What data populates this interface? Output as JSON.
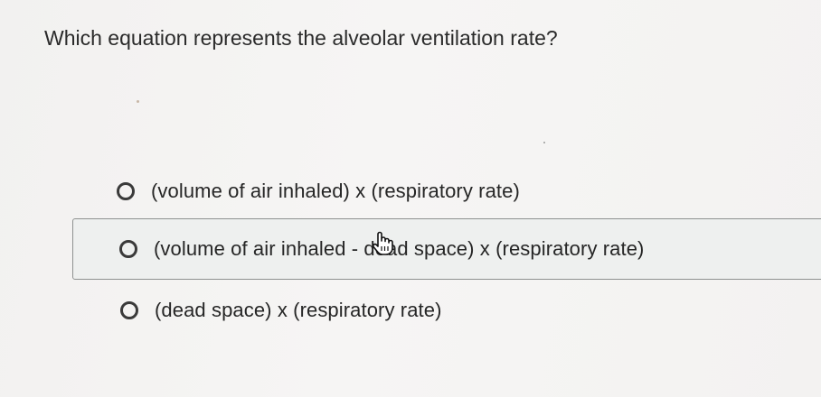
{
  "question": {
    "text": "Which equation represents the alveolar ventilation rate?"
  },
  "options": [
    {
      "label": "(volume of air inhaled) x (respiratory rate)",
      "selected": false,
      "hovered": false
    },
    {
      "label": "(volume of air inhaled - dead space) x (respiratory rate)",
      "selected": false,
      "hovered": true
    },
    {
      "label": "(dead space) x (respiratory rate)",
      "selected": false,
      "hovered": false
    }
  ],
  "icons": {
    "radio": "radio-unchecked-icon",
    "cursor": "hand-pointer-icon"
  },
  "colors": {
    "background": "#f4f3f2",
    "text": "#2a2a2a",
    "hover_background": "#eef0ef",
    "hover_border": "#8e9190",
    "radio_stroke": "#3a3a3a"
  }
}
